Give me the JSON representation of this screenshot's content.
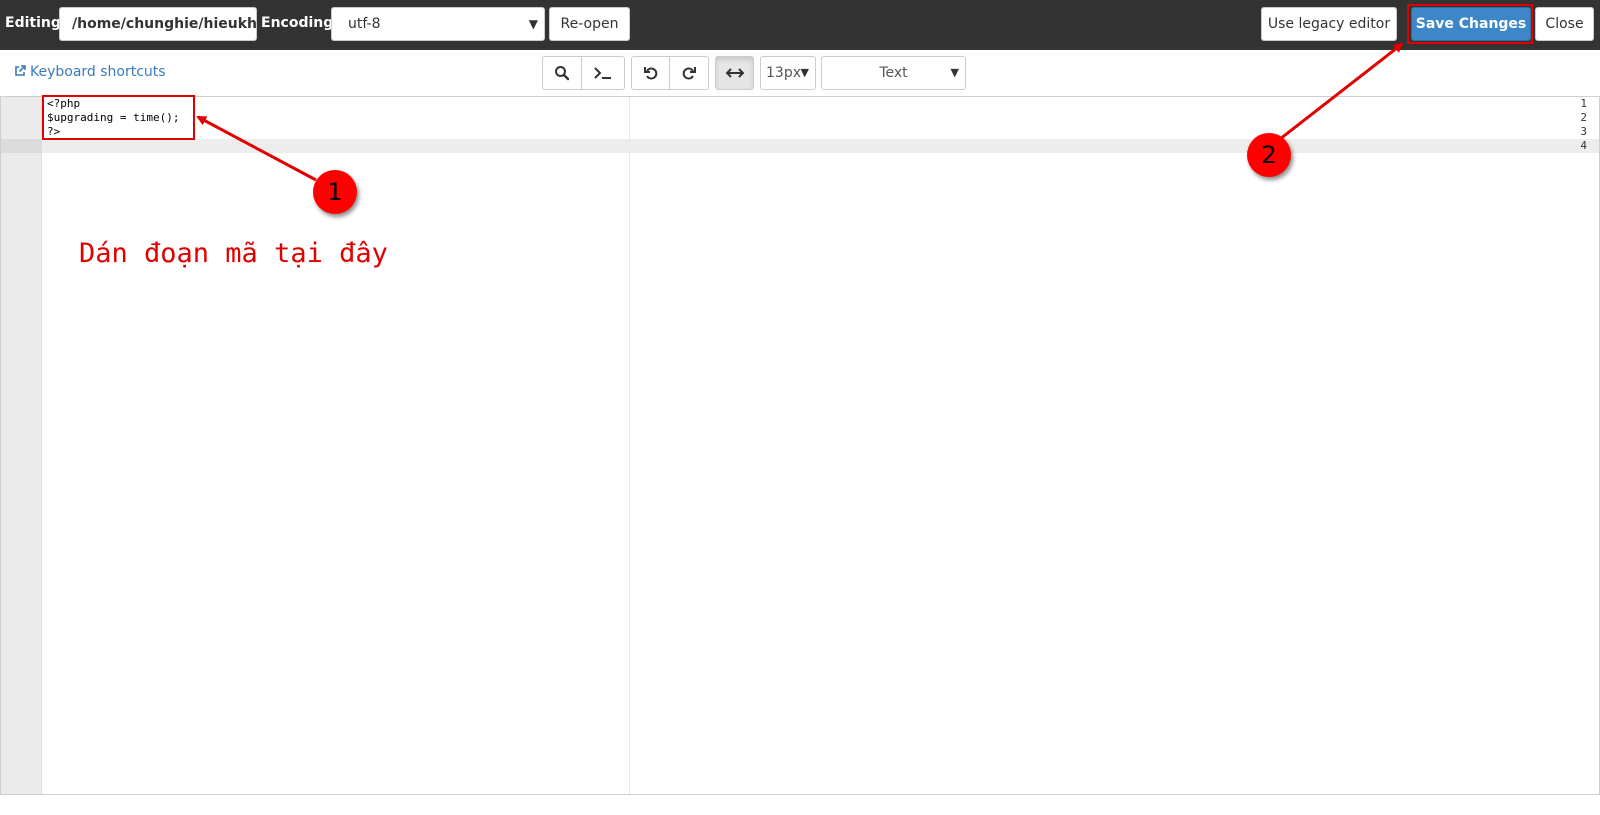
{
  "header": {
    "editing_label": "Editing:",
    "path_value": "/home/chunghie/hieukh",
    "encoding_label": "Encoding:",
    "encoding_value": "utf-8",
    "reopen_label": "Re-open",
    "legacy_label": "Use legacy editor",
    "save_label": "Save Changes",
    "close_label": "Close"
  },
  "toolbar": {
    "keyboard_shortcuts": "Keyboard shortcuts",
    "font_size": "13px",
    "mode": "Text",
    "tools": [
      "search-icon",
      "terminal-icon",
      "undo-icon",
      "redo-icon",
      "wrap-icon"
    ]
  },
  "editor": {
    "line_numbers": [
      "1",
      "2",
      "3",
      "4"
    ],
    "lines": [
      "<?php",
      "$upgrading = time();",
      "?>",
      ""
    ],
    "active_line": 4
  },
  "annotations": {
    "step1": "1",
    "step2": "2",
    "hint_text": "Dán đoạn mã tại đây"
  },
  "colors": {
    "topbar": "#333333",
    "primary": "#3d87c8",
    "annotation": "#ff0000",
    "link": "#3a7bbd"
  }
}
